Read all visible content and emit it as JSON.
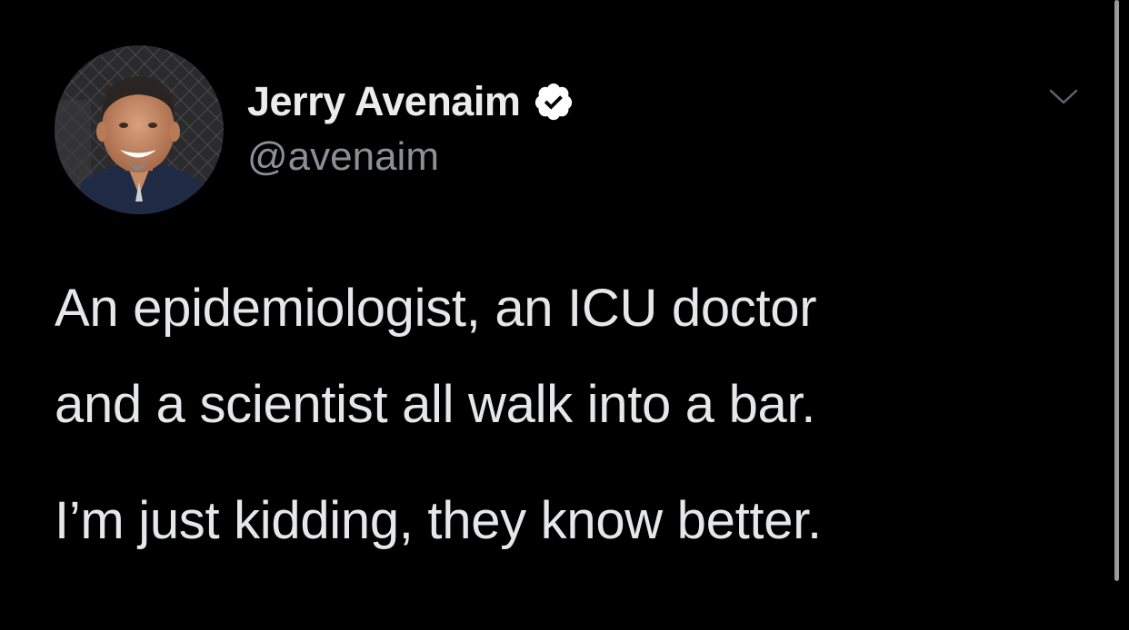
{
  "tweet": {
    "author": {
      "display_name": "Jerry Avenaim",
      "handle": "@avenaim",
      "verified": true,
      "avatar_icon": "profile-photo"
    },
    "text_lines": [
      "An epidemiologist, an ICU doctor",
      "and a scientist all walk into a bar.",
      "I’m just kidding, they know better."
    ],
    "menu_icon": "chevron-down-icon"
  },
  "colors": {
    "background": "#000000",
    "text": "#e6e7e9",
    "secondary_text": "#8b9096",
    "verified_badge": "#ffffff"
  }
}
